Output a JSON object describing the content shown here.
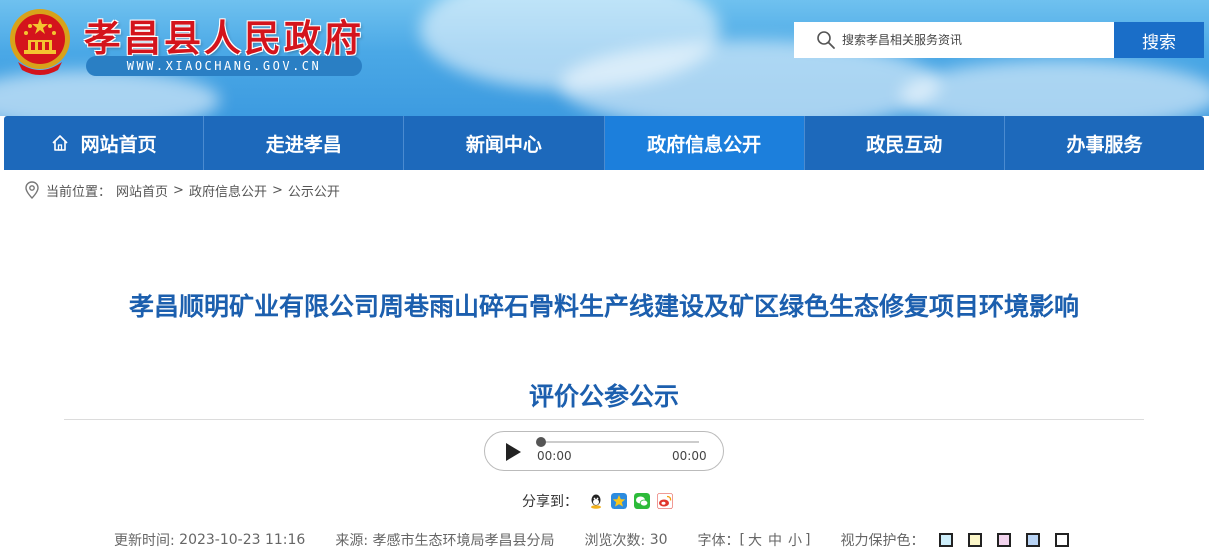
{
  "header": {
    "site_title": "孝昌县人民政府",
    "site_url": "WWW.XIAOCHANG.GOV.CN",
    "search": {
      "placeholder": "搜索孝昌相关服务资讯",
      "button_label": "搜索"
    }
  },
  "nav": {
    "items": [
      {
        "label": "网站首页",
        "icon": "home-icon"
      },
      {
        "label": "走进孝昌"
      },
      {
        "label": "新闻中心"
      },
      {
        "label": "政府信息公开",
        "active": true
      },
      {
        "label": "政民互动"
      },
      {
        "label": "办事服务"
      }
    ],
    "colors": {
      "bar": "#1d69bb",
      "active": "#1c7fdc"
    }
  },
  "breadcrumb": {
    "prefix": "当前位置：",
    "items": [
      "网站首页",
      "政府信息公开",
      "公示公开"
    ],
    "separator": ">"
  },
  "article": {
    "title_line1": "孝昌顺明矿业有限公司周巷雨山碎石骨料生产线建设及矿区绿色生态修复项目环境影响",
    "title_line2": "评价公参公示",
    "title_color": "#1c5fae"
  },
  "audio": {
    "current_time": "00:00",
    "total_time": "00:00"
  },
  "share": {
    "label": "分享到：",
    "icons": [
      "qq-icon",
      "qzone-icon",
      "wechat-icon",
      "weibo-icon"
    ]
  },
  "meta": {
    "updated_label": "更新时间:",
    "updated_value": "2023-10-23 11:16",
    "source_label": "来源:",
    "source_value": "孝感市生态环境局孝昌县分局",
    "views_label": "浏览次数:",
    "views_value": "30",
    "font_label": "字体：",
    "font_open": "[",
    "font_large": "大",
    "font_medium": "中",
    "font_small": "小",
    "font_close": "]",
    "vision_label": "视力保护色：",
    "vision_colors": [
      "#cdeefa",
      "#fbf6c8",
      "#f2d4ee",
      "#b9d4f5",
      "#ffffff"
    ]
  }
}
